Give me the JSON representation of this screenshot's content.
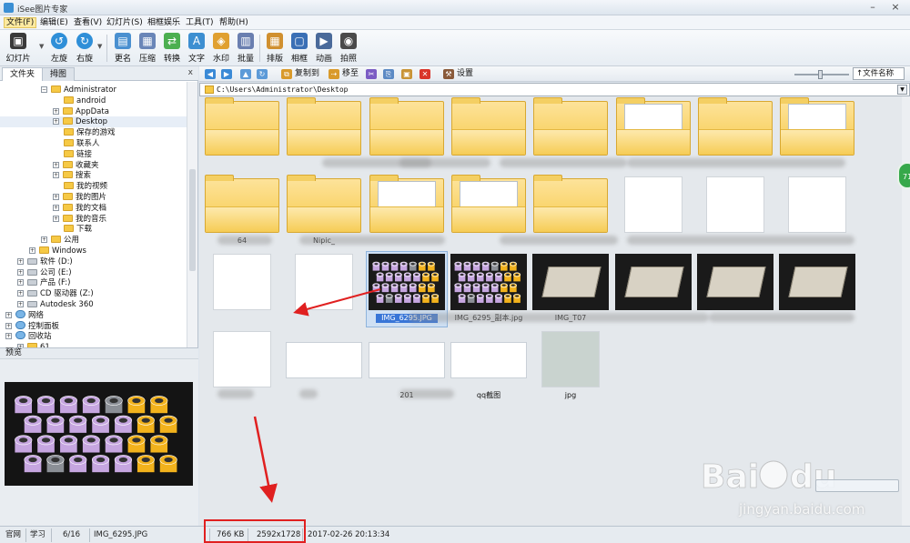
{
  "window": {
    "title": "iSee图片专家",
    "minimize": "–",
    "close": "×"
  },
  "menu": [
    {
      "label": "文件(F)"
    },
    {
      "label": "编辑(E)"
    },
    {
      "label": "查看(V)"
    },
    {
      "label": "幻灯片(S)"
    },
    {
      "label": "相框娱乐"
    },
    {
      "label": "工具(T)"
    },
    {
      "label": "帮助(H)"
    }
  ],
  "toolbar": [
    {
      "label": "幻灯片",
      "icon": "slideshow-icon",
      "color": "#3a3a3a"
    },
    {
      "label": "左旋",
      "icon": "rotate-left-icon",
      "color": "#2f8fd8"
    },
    {
      "label": "右旋",
      "icon": "rotate-right-icon",
      "color": "#2f8fd8"
    },
    {
      "label": "更名",
      "icon": "rename-icon",
      "color": "#4a90d0"
    },
    {
      "label": "压缩",
      "icon": "compress-icon",
      "color": "#6a86b8"
    },
    {
      "label": "转换",
      "icon": "convert-icon",
      "color": "#4caf50"
    },
    {
      "label": "文字",
      "icon": "text-icon",
      "color": "#3d8fd1"
    },
    {
      "label": "水印",
      "icon": "watermark-icon",
      "color": "#e0a030"
    },
    {
      "label": "批量",
      "icon": "batch-icon",
      "color": "#6a7fb0"
    },
    {
      "label": "排版",
      "icon": "layout-icon",
      "color": "#d09030"
    },
    {
      "label": "相框",
      "icon": "frame-icon",
      "color": "#3a6fb5"
    },
    {
      "label": "动画",
      "icon": "animation-icon",
      "color": "#4a6a9a"
    },
    {
      "label": "拍照",
      "icon": "camera-icon",
      "color": "#4a4a4a"
    }
  ],
  "left_tabs": [
    {
      "label": "文件夹"
    },
    {
      "label": "拇图"
    }
  ],
  "left_pin": "x",
  "tree": [
    {
      "label": "Administrator",
      "indent": 45,
      "expander": "−",
      "icon": "folder"
    },
    {
      "label": "android",
      "indent": 70,
      "icon": "folder"
    },
    {
      "label": "AppData",
      "indent": 58,
      "expander": "+",
      "icon": "folder"
    },
    {
      "label": "Desktop",
      "indent": 58,
      "expander": "+",
      "icon": "folder",
      "selected": true
    },
    {
      "label": "保存的游戏",
      "indent": 70,
      "icon": "folder"
    },
    {
      "label": "联系人",
      "indent": 70,
      "icon": "folder"
    },
    {
      "label": "链接",
      "indent": 70,
      "icon": "folder"
    },
    {
      "label": "收藏夹",
      "indent": 58,
      "expander": "+",
      "icon": "folder"
    },
    {
      "label": "搜索",
      "indent": 58,
      "expander": "+",
      "icon": "folder"
    },
    {
      "label": "我的视频",
      "indent": 70,
      "icon": "folder"
    },
    {
      "label": "我的图片",
      "indent": 58,
      "expander": "+",
      "icon": "folder"
    },
    {
      "label": "我的文档",
      "indent": 58,
      "expander": "+",
      "icon": "folder"
    },
    {
      "label": "我的音乐",
      "indent": 58,
      "expander": "+",
      "icon": "folder"
    },
    {
      "label": "下载",
      "indent": 70,
      "icon": "folder"
    },
    {
      "label": "公用",
      "indent": 45,
      "expander": "+",
      "icon": "folder"
    },
    {
      "label": "Windows",
      "indent": 32,
      "expander": "+",
      "icon": "folder"
    },
    {
      "label": "软件 (D:)",
      "indent": 19,
      "expander": "+",
      "icon": "drive"
    },
    {
      "label": "公司 (E:)",
      "indent": 19,
      "expander": "+",
      "icon": "drive"
    },
    {
      "label": "产品 (F:)",
      "indent": 19,
      "expander": "+",
      "icon": "drive"
    },
    {
      "label": "CD 驱动器 (Z:)",
      "indent": 19,
      "expander": "+",
      "icon": "drive"
    },
    {
      "label": "Autodesk 360",
      "indent": 19,
      "expander": "+",
      "icon": "drive"
    },
    {
      "label": "网络",
      "indent": 6,
      "expander": "+",
      "icon": "network"
    },
    {
      "label": "控制面板",
      "indent": 6,
      "expander": "+",
      "icon": "network"
    },
    {
      "label": "回收站",
      "indent": 6,
      "expander": "+",
      "icon": "network"
    },
    {
      "label": "61",
      "indent": 19,
      "expander": "+",
      "icon": "folder"
    }
  ],
  "preview": {
    "title": "预览"
  },
  "nav": {
    "copy_to": "复制到",
    "move_to": "移至",
    "settings": "设置",
    "sort": "↑文件名称"
  },
  "address": {
    "path": "C:\\Users\\Administrator\\Desktop"
  },
  "grid": [
    {
      "label": "",
      "kind": "folder"
    },
    {
      "label": "",
      "kind": "folder"
    },
    {
      "label": "",
      "kind": "folder"
    },
    {
      "label": "",
      "kind": "folder"
    },
    {
      "label": "",
      "kind": "folder"
    },
    {
      "label": "",
      "kind": "folder-doc"
    },
    {
      "label": "",
      "kind": "folder"
    },
    {
      "label": "",
      "kind": "folder-doc"
    },
    {
      "label": "64",
      "kind": "folder"
    },
    {
      "label": "Nipic_",
      "kind": "folder"
    },
    {
      "label": "",
      "kind": "folder-doc"
    },
    {
      "label": "",
      "kind": "folder-doc"
    },
    {
      "label": "",
      "kind": "folder"
    },
    {
      "label": "",
      "kind": "doc"
    },
    {
      "label": "",
      "kind": "doc"
    },
    {
      "label": "",
      "kind": "doc"
    },
    {
      "label": "",
      "kind": "doc"
    },
    {
      "label": "",
      "kind": "doc"
    },
    {
      "label": "IMG_6295.JPG",
      "kind": "tubes",
      "selected": true
    },
    {
      "label": "IMG_6295_副本.jpg",
      "kind": "tubes"
    },
    {
      "label": "IMG_T07",
      "kind": "tray"
    },
    {
      "label": "",
      "kind": "tray"
    },
    {
      "label": "",
      "kind": "tray"
    },
    {
      "label": "",
      "kind": "tray"
    },
    {
      "label": "",
      "kind": "doc"
    },
    {
      "label": "",
      "kind": "screen"
    },
    {
      "label": "201",
      "kind": "screen"
    },
    {
      "label": "qq截图",
      "kind": "screen"
    },
    {
      "label": "jpg",
      "kind": "scan"
    }
  ],
  "status": {
    "site": "官网",
    "learn": "学习",
    "index": "6/16",
    "filename": "IMG_6295.JPG",
    "size": "766 KB",
    "dimensions": "2592x1728",
    "datetime": "2017-02-26 20:13:34"
  },
  "side_badge": "71",
  "watermark": {
    "url": "jingyan.baidu.com"
  },
  "colors": {
    "selection": "#3875d7",
    "annotation": "#e02020",
    "folder": "#f7c948"
  }
}
